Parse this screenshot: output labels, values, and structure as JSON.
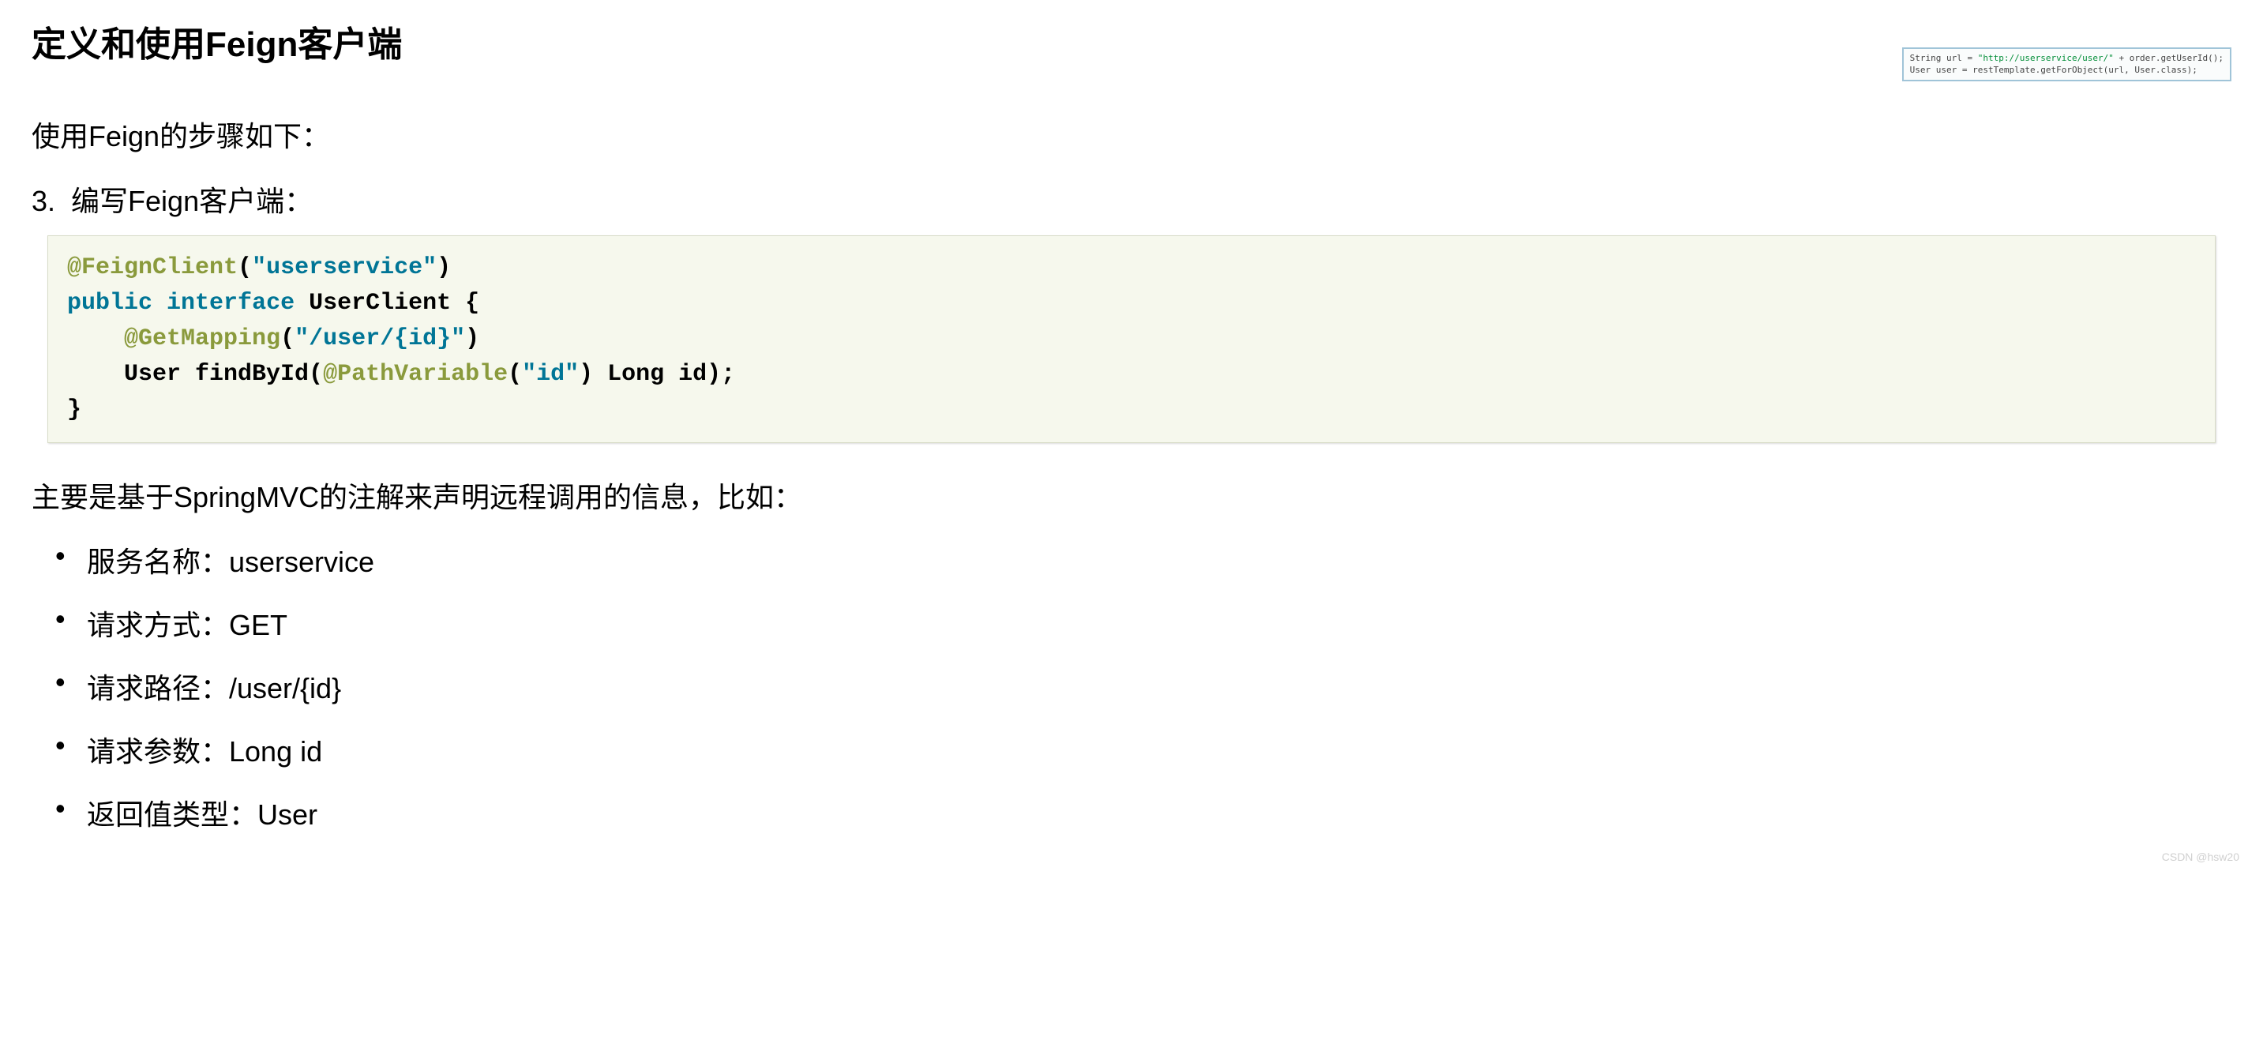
{
  "title": "定义和使用Feign客户端",
  "intro": "使用Feign的步骤如下：",
  "step_number": "3.",
  "step_text": "编写Feign客户端：",
  "code": {
    "line1_ann": "@FeignClient",
    "line1_paren_open": "(",
    "line1_str": "\"userservice\"",
    "line1_paren_close": ")",
    "line2_kw1": "public",
    "line2_kw2": "interface",
    "line2_rest": " UserClient {",
    "line3_indent": "    ",
    "line3_ann": "@GetMapping",
    "line3_paren_open": "(",
    "line3_str": "\"/user/{id}\"",
    "line3_paren_close": ")",
    "line4_indent": "    ",
    "line4_pre": "User findById(",
    "line4_ann": "@PathVariable",
    "line4_paren_open": "(",
    "line4_str": "\"id\"",
    "line4_paren_close": ")",
    "line4_post": " Long id);",
    "line5": "}"
  },
  "desc": "主要是基于SpringMVC的注解来声明远程调用的信息，比如：",
  "bullets": [
    "服务名称：userservice",
    "请求方式：GET",
    "请求路径：/user/{id}",
    "请求参数：Long id",
    "返回值类型：User"
  ],
  "snippet": {
    "line1_pre": "String url = ",
    "line1_str": "\"http://userservice/user/\"",
    "line1_post": " + order.getUserId();",
    "line2": "User user = restTemplate.getForObject(url, User.class);"
  },
  "watermark": "CSDN @hsw20"
}
